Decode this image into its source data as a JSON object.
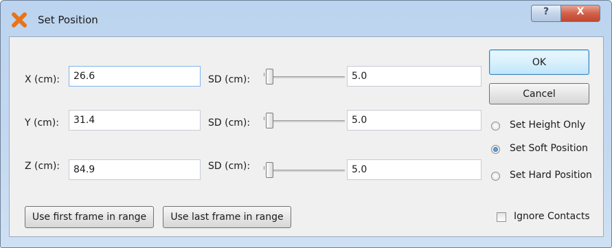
{
  "window": {
    "title": "Set Position",
    "help_label": "?",
    "close_label": "X"
  },
  "rows": [
    {
      "axis_label": "X (cm):",
      "value": "26.6",
      "sd_label": "SD (cm):",
      "sd_value": "5.0"
    },
    {
      "axis_label": "Y (cm):",
      "value": "31.4",
      "sd_label": "SD (cm):",
      "sd_value": "5.0"
    },
    {
      "axis_label": "Z (cm):",
      "value": "84.9",
      "sd_label": "SD (cm):",
      "sd_value": "5.0"
    }
  ],
  "buttons": {
    "ok": "OK",
    "cancel": "Cancel",
    "use_first": "Use first frame in range",
    "use_last": "Use last frame in range"
  },
  "options": {
    "set_height_only": "Set Height Only",
    "set_soft_position": "Set Soft Position",
    "set_hard_position": "Set Hard Position",
    "selected": "Set Soft Position",
    "ignore_contacts": "Ignore Contacts",
    "ignore_contacts_checked": false
  },
  "colors": {
    "accent": "#3c7fb1",
    "close": "#c24630",
    "title_icon": "#e8731a"
  }
}
